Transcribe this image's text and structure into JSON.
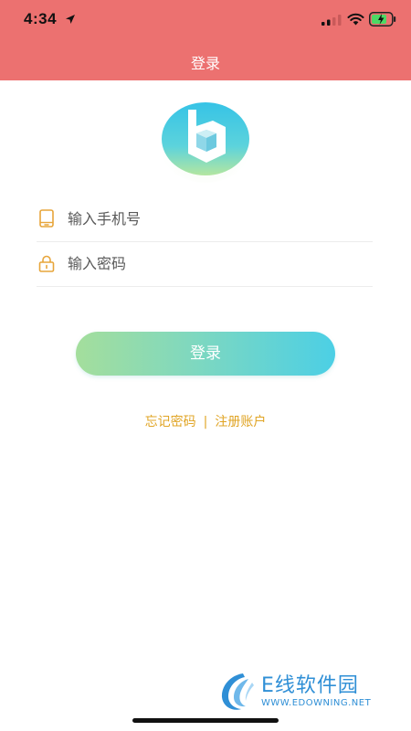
{
  "status_bar": {
    "time": "4:34",
    "icons": [
      "location-arrow-icon",
      "signal-icon",
      "wifi-icon",
      "battery-icon"
    ]
  },
  "nav": {
    "title": "登录",
    "background": "#ec7170"
  },
  "logo": {
    "icon": "app-logo-b-icon",
    "letter": "b"
  },
  "form": {
    "phone": {
      "icon": "phone-icon",
      "placeholder": "输入手机号",
      "value": ""
    },
    "password": {
      "icon": "lock-icon",
      "placeholder": "输入密码",
      "value": ""
    }
  },
  "login_button": {
    "label": "登录",
    "gradient": [
      "#a4de9c",
      "#4ccfe5"
    ]
  },
  "links": {
    "forgot_password": "忘记密码",
    "separator": "|",
    "register": "注册账户",
    "color": "#e0a424"
  },
  "watermark": {
    "title": "E线软件园",
    "subtitle": "WWW.EDOWNING.NET",
    "color": "#2f8fd6"
  }
}
